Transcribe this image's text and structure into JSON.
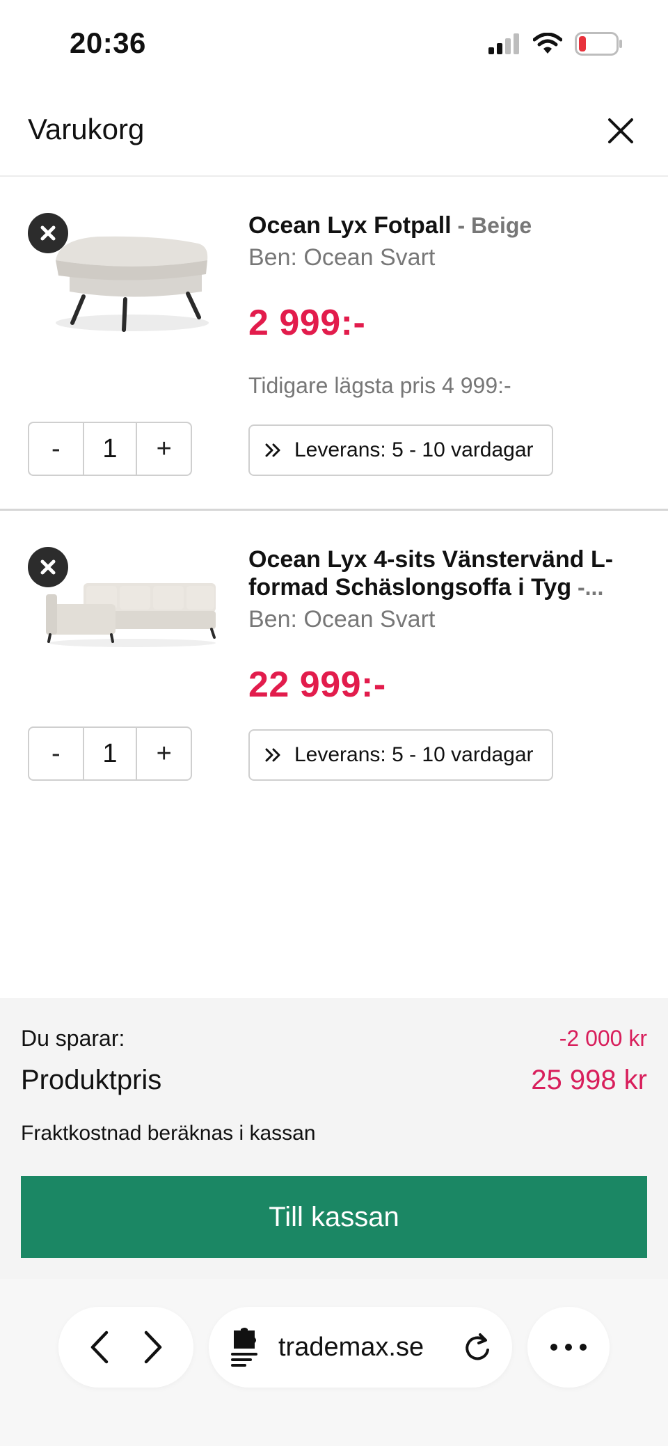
{
  "status_bar": {
    "time": "20:36",
    "icons": [
      "cellular-signal-icon",
      "wifi-icon",
      "battery-low-icon"
    ]
  },
  "header": {
    "title": "Varukorg",
    "close_icon": "close-icon"
  },
  "items": [
    {
      "name": "Ocean Lyx Fotpall",
      "variant": " - Beige",
      "legs": "Ben: Ocean Svart",
      "price": "2 999:-",
      "previous_price": "Tidigare lägsta pris 4 999:-",
      "quantity": "1",
      "qty_minus": "-",
      "qty_plus": "+",
      "delivery": "Leverans: 5 - 10 vardagar",
      "image": "footstool-image"
    },
    {
      "name": "Ocean Lyx 4-sits Vänstervänd L-formad Schäslongsoffa i Tyg",
      "variant": " -...",
      "legs": "Ben: Ocean Svart",
      "price": "22 999:-",
      "quantity": "1",
      "qty_minus": "-",
      "qty_plus": "+",
      "delivery": "Leverans: 5 - 10 vardagar",
      "image": "corner-sofa-image"
    }
  ],
  "summary": {
    "savings_label": "Du sparar:",
    "savings_value": "-2 000 kr",
    "total_label": "Produktpris",
    "total_value": "25 998 kr",
    "shipping_note": "Fraktkostnad beräknas i kassan",
    "checkout_label": "Till kassan"
  },
  "browser": {
    "url": "trademax.se",
    "icons": [
      "back-icon",
      "forward-icon",
      "extensions-icon",
      "reload-icon",
      "more-icon"
    ]
  },
  "colors": {
    "price_red": "#e21c4c",
    "accent_pink": "#d81e5b",
    "checkout_green": "#1b8764",
    "muted_gray": "#777777"
  }
}
